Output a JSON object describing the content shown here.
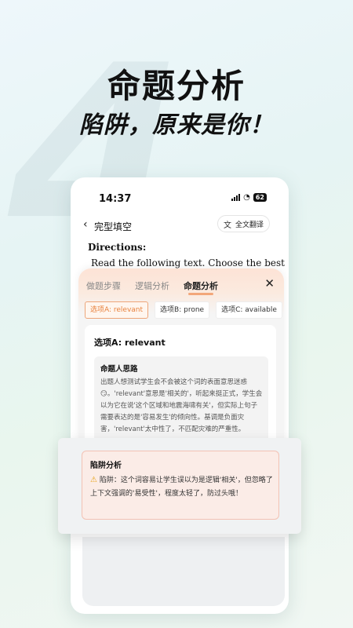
{
  "hero": {
    "bg_number": "4",
    "headline": "命题分析",
    "subheadline": "陷阱，原来是你！"
  },
  "status_bar": {
    "time": "14:37",
    "battery": "62"
  },
  "nav": {
    "title": "完型填空",
    "translate_label": "全文翻译"
  },
  "content": {
    "directions": "Directions:",
    "text": "Read the following text. Choose the best"
  },
  "panel": {
    "tabs": [
      {
        "label": "做题步骤",
        "active": false
      },
      {
        "label": "逻辑分析",
        "active": false
      },
      {
        "label": "命题分析",
        "active": true
      }
    ],
    "chips": [
      {
        "label": "选项A: relevant",
        "active": true
      },
      {
        "label": "选项B: prone",
        "active": false
      },
      {
        "label": "选项C: available",
        "active": false
      }
    ],
    "option_title": "选项A: relevant",
    "thought_title": "命题人思路",
    "thought_text": "出题人想测试学生会不会被这个词的表面意思迷惑😏。'relevant'意思是'相关的'，听起来挺正式，学生会以为它在说'这个区域和地震海啸有关'，但实际上句子需要表达的是'容易发生'的倾向性。基调是负面灾害，'relevant'太中性了，不匹配灾难的严重性。"
  },
  "trap": {
    "title": "陷阱分析",
    "text": "陷阱：这个词容易让学生误以为是逻辑'相关'，但忽略了上下文强调的'易受性'，程度太轻了，防过头哦！"
  },
  "colors": {
    "accent": "#e8823e",
    "trap_bg": "#fbece7"
  }
}
